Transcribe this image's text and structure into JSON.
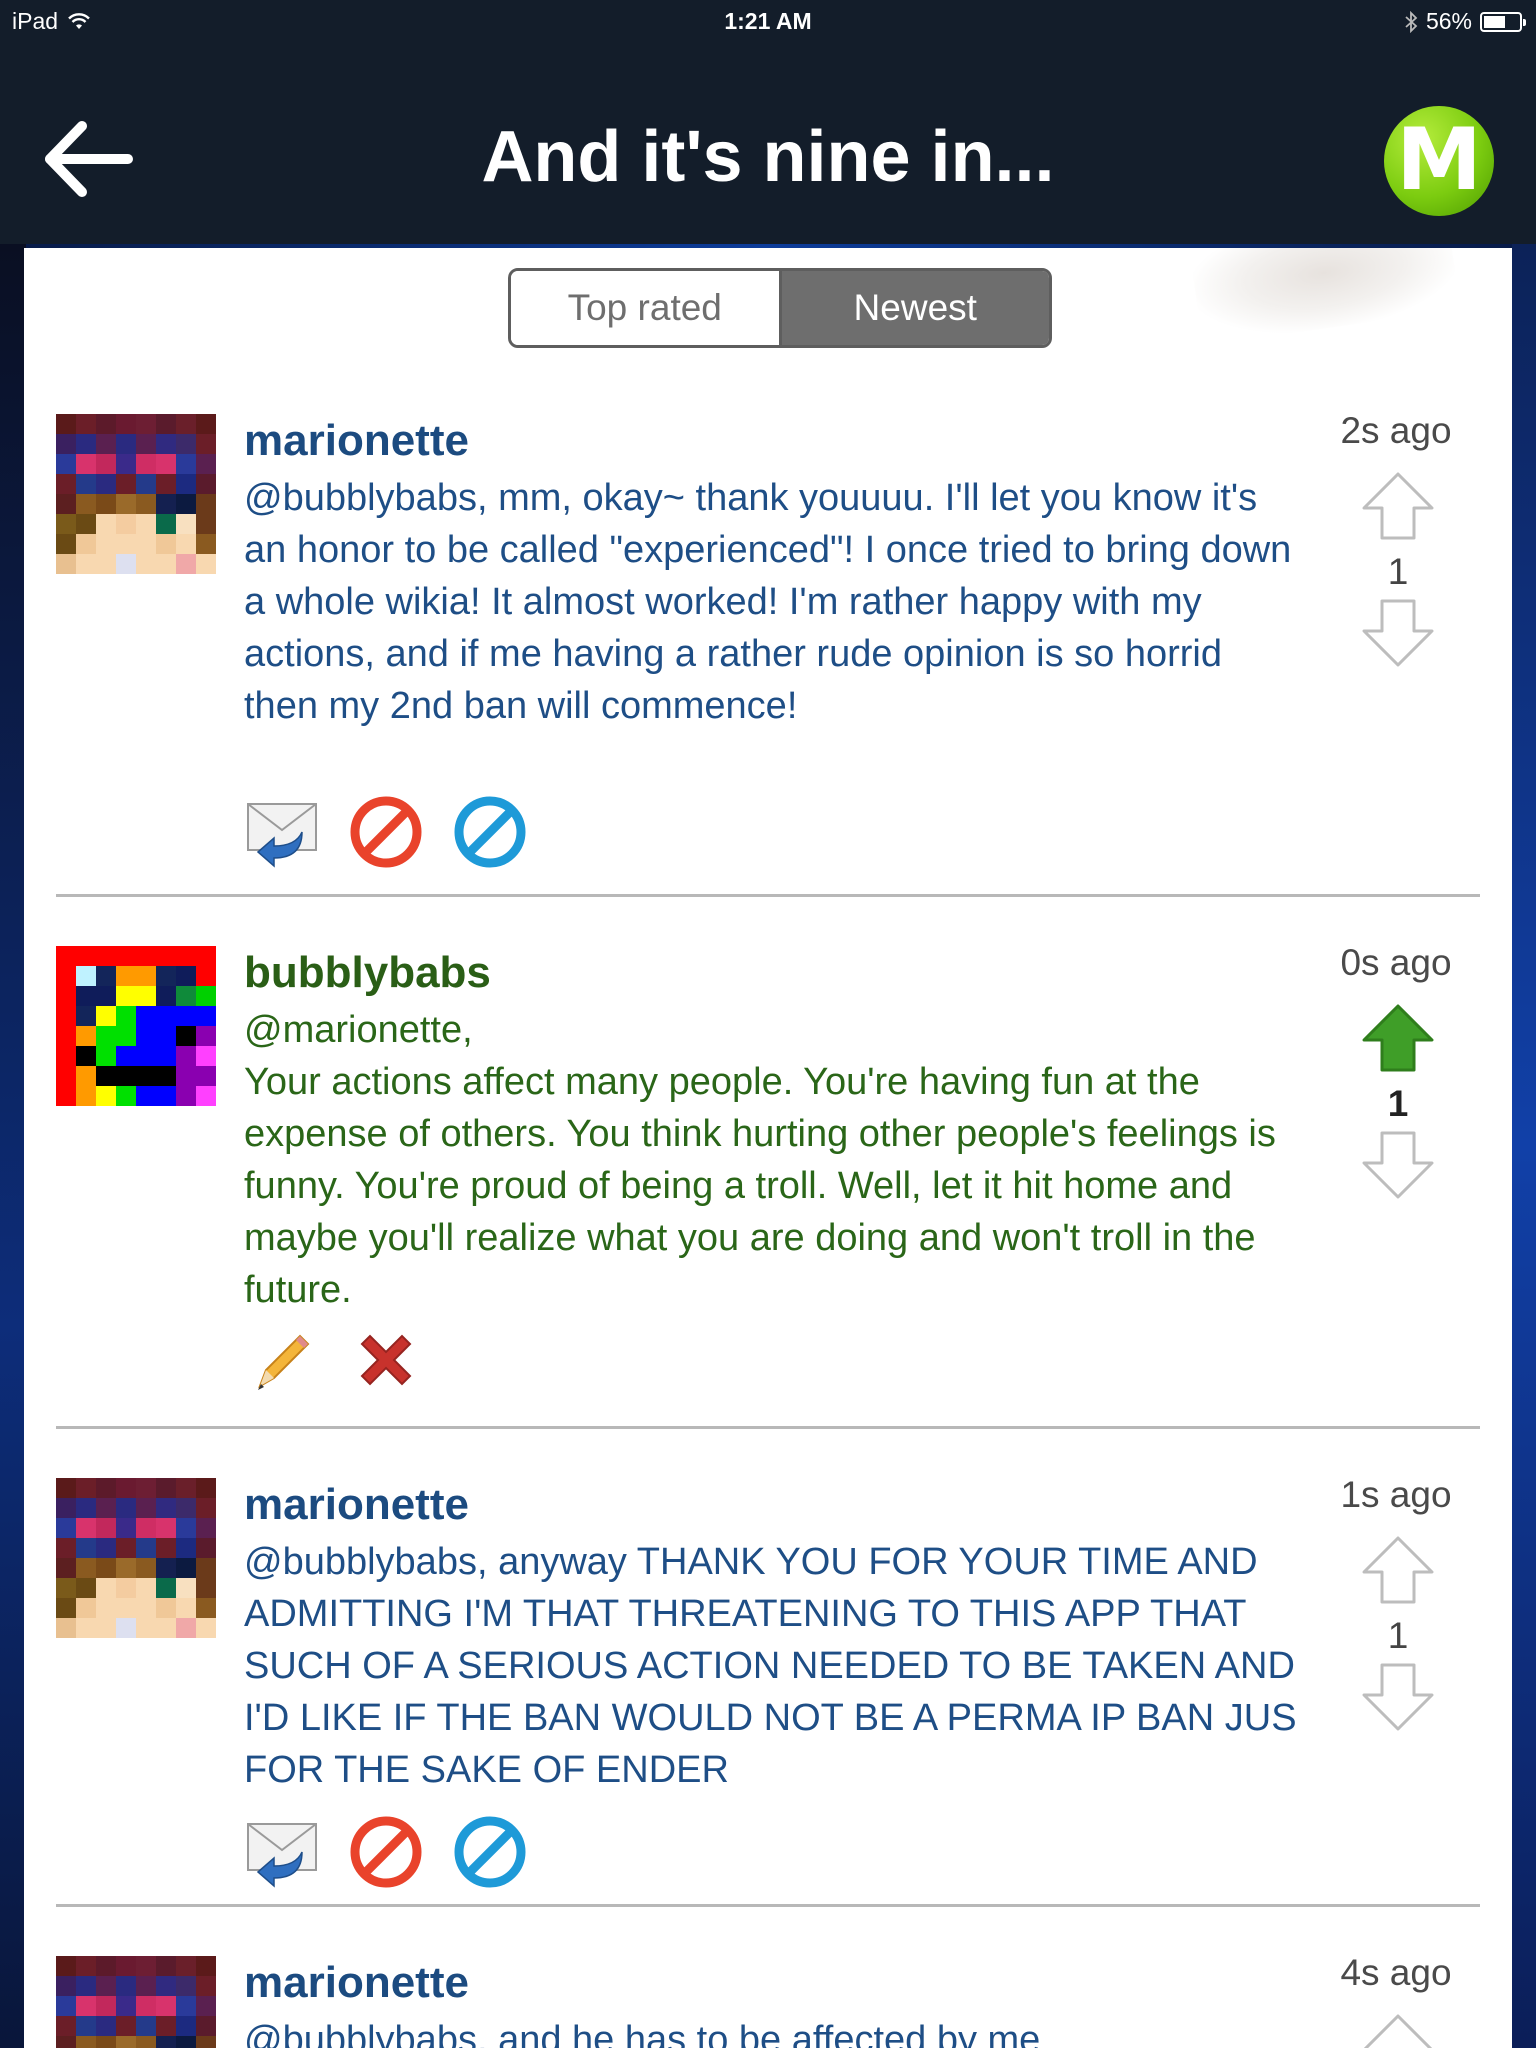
{
  "status_bar": {
    "device": "iPad",
    "time": "1:21 AM",
    "battery": "56%",
    "battery_level": 0.56
  },
  "nav": {
    "title": "And it's nine in...",
    "logo_letter": "M"
  },
  "sort_tabs": {
    "top_rated": "Top rated",
    "newest": "Newest",
    "selected": "Newest"
  },
  "comments": [
    {
      "username": "marionette",
      "text": "@bubblybabs, mm, okay~ thank youuuu. I'll let you know it's an honor to be called \"experienced\"! I once tried to bring down a whole wikia! It almost worked! I'm rather happy with my actions, and if me having a rather rude opinion is so horrid then my 2nd ban will commence!",
      "time": "2s ago",
      "votes": "1",
      "upvoted": false,
      "actions": [
        "reply-icon",
        "block-icon",
        "report-icon"
      ]
    },
    {
      "username": "bubblybabs",
      "mention": "@marionette,",
      "text": "Your actions affect many people. You're having fun at the expense of others. You think hurting other people's feelings is funny. You're proud of being a troll. Well, let it hit home and maybe you'll realize what you are doing and won't troll in the future.",
      "time": "0s ago",
      "votes": "1",
      "upvoted": true,
      "actions": [
        "edit-icon",
        "delete-icon"
      ]
    },
    {
      "username": "marionette",
      "text": "@bubblybabs, anyway THANK YOU FOR YOUR TIME AND ADMITTING I'M THAT THREATENING TO THIS APP THAT SUCH OF A SERIOUS ACTION NEEDED TO BE TAKEN AND I'D LIKE IF THE BAN WOULD NOT BE A PERMA IP BAN JUS FOR THE SAKE OF ENDER",
      "time": "1s ago",
      "votes": "1",
      "upvoted": false,
      "actions": [
        "reply-icon",
        "block-icon",
        "report-icon"
      ]
    },
    {
      "username": "marionette",
      "text": "@bubblybabs, and he has to be affected by me",
      "time": "4s ago"
    }
  ],
  "colors": {
    "nav_bg": "#131d2a",
    "marionette_text": "#1e4e86",
    "bubblybabs_text": "#2a6618",
    "upvote_green": "#3f9e28",
    "logo_green": "#7ccc10"
  }
}
